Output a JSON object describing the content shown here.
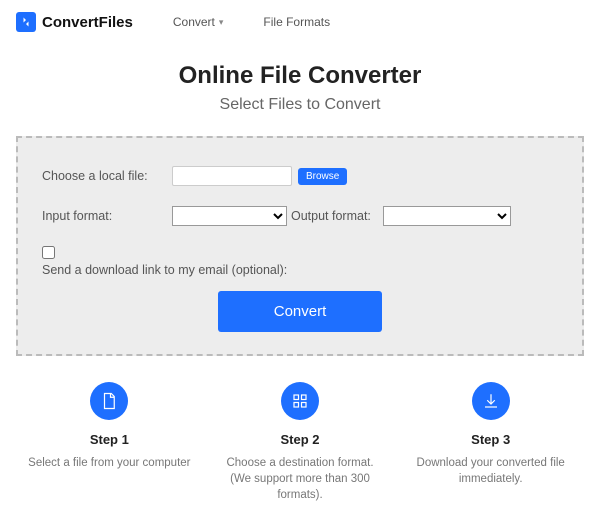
{
  "brand": "ConvertFiles",
  "nav": {
    "convert": "Convert",
    "formats": "File Formats"
  },
  "heading": "Online File Converter",
  "subtitle": "Select Files to Convert",
  "form": {
    "choose_label": "Choose a local file:",
    "browse": "Browse",
    "input_format_label": "Input format:",
    "output_format_label": "Output format:",
    "email_label": "Send a download link to my email (optional):",
    "convert": "Convert"
  },
  "steps": [
    {
      "title": "Step 1",
      "desc": "Select a file from your computer"
    },
    {
      "title": "Step 2",
      "desc": "Choose a destination format. (We support more than 300 formats)."
    },
    {
      "title": "Step 3",
      "desc": "Download your converted file immediately."
    }
  ]
}
